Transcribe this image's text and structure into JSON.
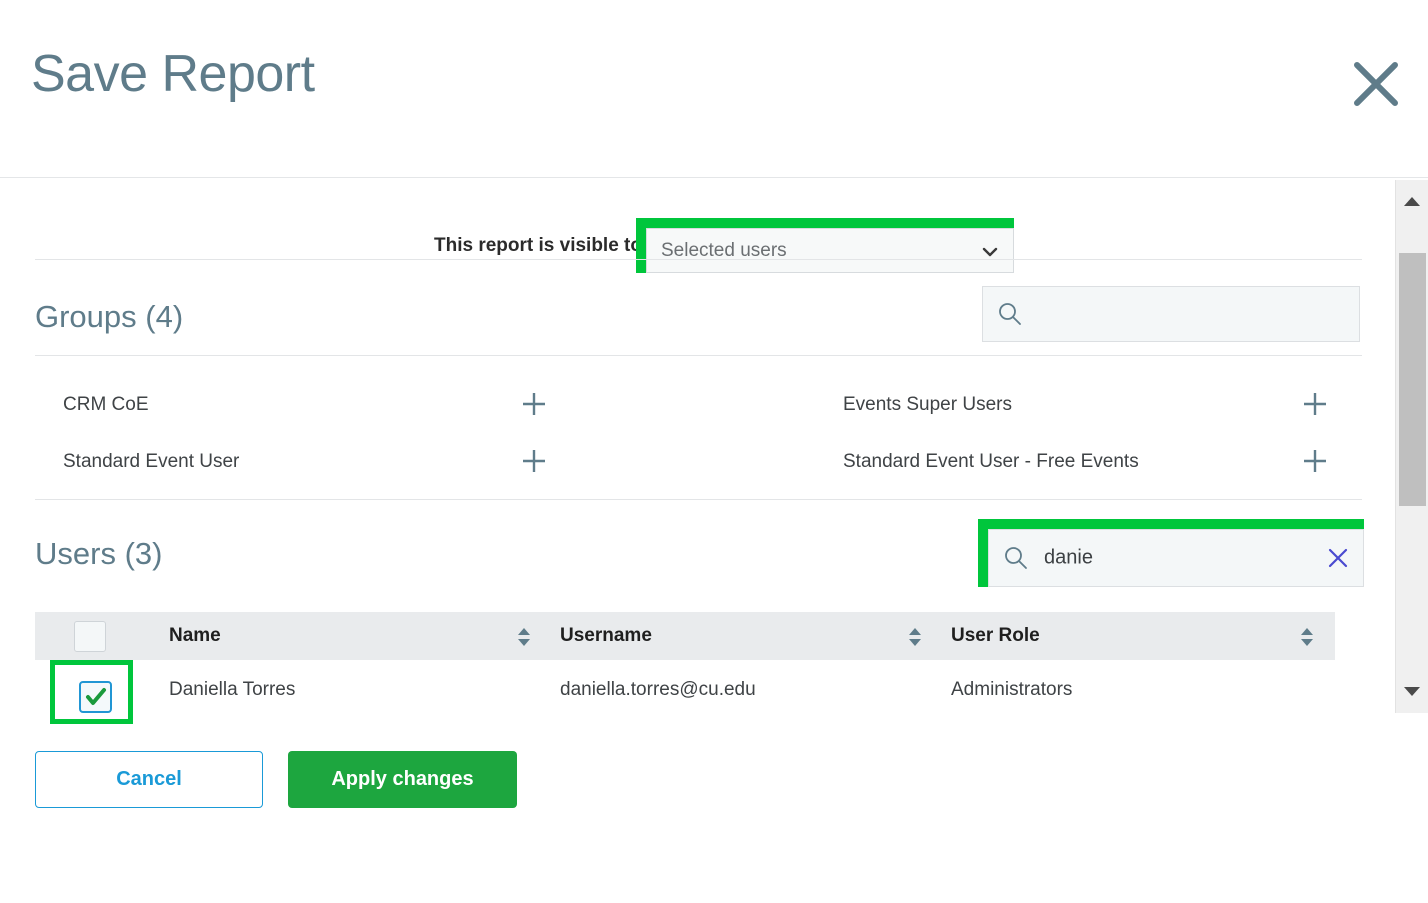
{
  "header": {
    "title": "Save Report",
    "close_icon": "close-icon"
  },
  "visibility": {
    "label": "This report is visible to",
    "selected": "Selected users",
    "options": [
      "Selected users"
    ],
    "chevron_icon": "chevron-down-icon",
    "highlight_color": "#00c63c"
  },
  "groups": {
    "heading": "Groups (4)",
    "count": 4,
    "search": {
      "value": "",
      "placeholder": "",
      "icon": "search-icon"
    },
    "items": [
      {
        "label": "CRM CoE",
        "add_icon": "plus-icon"
      },
      {
        "label": "Events Super Users",
        "add_icon": "plus-icon"
      },
      {
        "label": "Standard Event User",
        "add_icon": "plus-icon"
      },
      {
        "label": "Standard Event User - Free Events",
        "add_icon": "plus-icon"
      }
    ]
  },
  "users": {
    "heading": "Users (3)",
    "count": 3,
    "search": {
      "value": "danie",
      "placeholder": "",
      "icon": "search-icon",
      "clear_icon": "close-icon",
      "highlight_color": "#00c63c"
    },
    "table": {
      "columns": [
        {
          "label": "Name",
          "sort_icon": "sort-diamond-icon"
        },
        {
          "label": "Username",
          "sort_icon": "sort-diamond-icon"
        },
        {
          "label": "User Role",
          "sort_icon": "sort-diamond-icon"
        }
      ],
      "select_all_checked": false,
      "rows": [
        {
          "checked": true,
          "name": "Daniella Torres",
          "username": "daniella.torres@cu.edu",
          "role": "Administrators"
        }
      ]
    }
  },
  "footer": {
    "cancel_label": "Cancel",
    "apply_label": "Apply changes",
    "cancel_color": "#1a9ad7",
    "apply_color": "#1da63f"
  },
  "scrollbar": {
    "up_icon": "triangle-up-icon",
    "down_icon": "triangle-down-icon"
  }
}
